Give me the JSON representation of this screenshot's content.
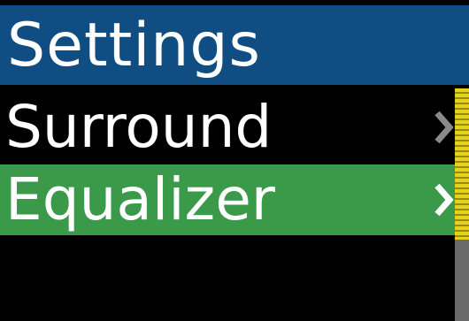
{
  "title": "Settings",
  "menu": {
    "items": [
      {
        "label": "Surround",
        "selected": false,
        "chevron_icon": "chevron-right-icon"
      },
      {
        "label": "Equalizer",
        "selected": true,
        "chevron_icon": "chevron-right-icon"
      }
    ]
  },
  "scrollbar": {
    "thumb_fraction": 0.65
  },
  "colors": {
    "title_bar": "#0f4d82",
    "selected_row": "#3a9a4a",
    "background": "#000000",
    "scroll_thumb": "#e5d21a"
  }
}
